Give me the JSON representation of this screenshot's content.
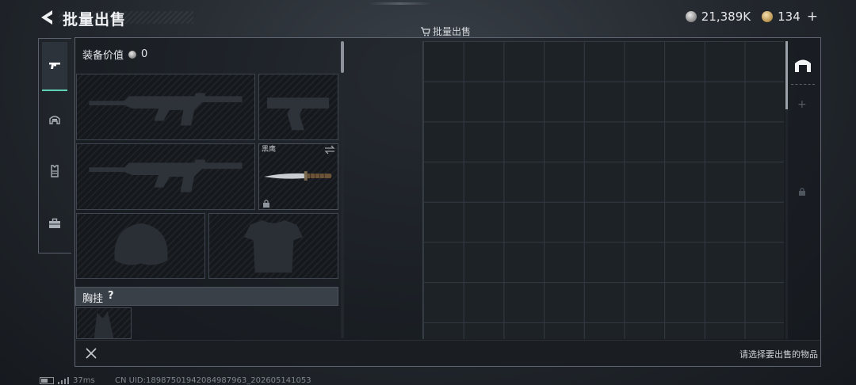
{
  "header": {
    "title": "批量出售",
    "currency": [
      {
        "icon": "silver-coin-icon",
        "value": "21,389K"
      },
      {
        "icon": "gold-coin-icon",
        "value": "134"
      }
    ],
    "plus_label": "+"
  },
  "frame_label": "批量出售",
  "tabs": [
    {
      "icon": "gun-icon",
      "active": true
    },
    {
      "icon": "helmet-icon",
      "active": false
    },
    {
      "icon": "vest-icon",
      "active": false
    },
    {
      "icon": "briefcase-icon",
      "active": false
    }
  ],
  "equipment": {
    "label": "装备价值",
    "value": "0",
    "melee_name": "黑鹰",
    "vest_label": "胸挂",
    "vest_help": "?"
  },
  "bottom": {
    "hint": "请选择要出售的物品"
  },
  "footer": {
    "ping": "37ms",
    "uid": "CN UID:1898750194208498796​3_202605141053"
  },
  "colors": {
    "accent": "#5fd1b4",
    "frame_border": "#5d6470"
  }
}
